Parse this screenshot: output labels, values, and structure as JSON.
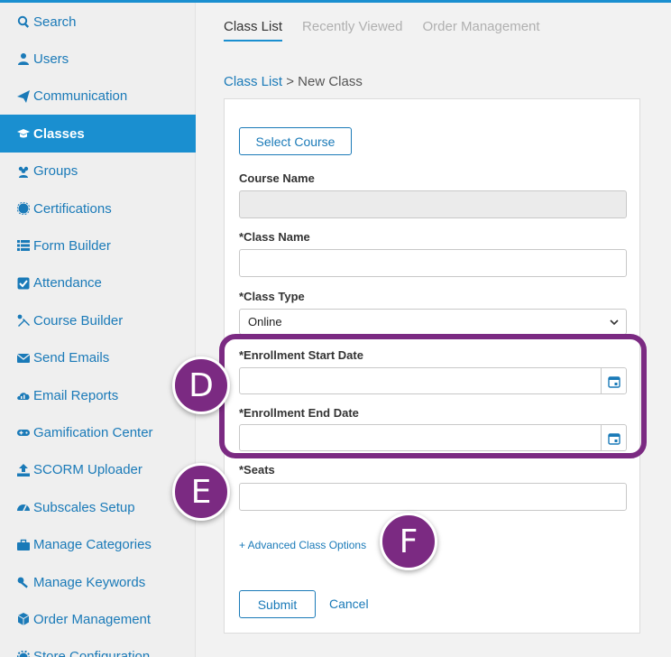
{
  "sidebar": {
    "items": [
      {
        "label": "Search",
        "icon": "search-icon"
      },
      {
        "label": "Users",
        "icon": "user-icon"
      },
      {
        "label": "Communication",
        "icon": "paper-plane-icon"
      },
      {
        "label": "Classes",
        "icon": "graduation-cap-icon",
        "active": true
      },
      {
        "label": "Groups",
        "icon": "users-icon"
      },
      {
        "label": "Certifications",
        "icon": "certificate-icon"
      },
      {
        "label": "Form Builder",
        "icon": "list-icon"
      },
      {
        "label": "Attendance",
        "icon": "check-square-icon"
      },
      {
        "label": "Course Builder",
        "icon": "tools-icon"
      },
      {
        "label": "Send Emails",
        "icon": "envelope-icon"
      },
      {
        "label": "Email Reports",
        "icon": "chart-cloud-icon"
      },
      {
        "label": "Gamification Center",
        "icon": "gamepad-icon"
      },
      {
        "label": "SCORM Uploader",
        "icon": "upload-icon"
      },
      {
        "label": "Subscales Setup",
        "icon": "gauge-icon"
      },
      {
        "label": "Manage Categories",
        "icon": "briefcase-icon"
      },
      {
        "label": "Manage Keywords",
        "icon": "key-icon"
      },
      {
        "label": "Order Management",
        "icon": "cube-icon"
      },
      {
        "label": "Store Configuration",
        "icon": "gear-icon"
      }
    ]
  },
  "tabs": [
    {
      "label": "Class List",
      "active": true
    },
    {
      "label": "Recently Viewed"
    },
    {
      "label": "Order Management"
    }
  ],
  "breadcrumb": {
    "link": "Class List",
    "separator": " > ",
    "current": "New Class"
  },
  "form": {
    "select_course_label": "Select Course",
    "course_name_label": "Course Name",
    "course_name_value": "",
    "class_name_label": "*Class Name",
    "class_name_value": "",
    "class_type_label": "*Class Type",
    "class_type_value": "Online",
    "enroll_start_label": "*Enrollment Start Date",
    "enroll_start_value": "",
    "enroll_end_label": "*Enrollment End Date",
    "enroll_end_value": "",
    "seats_label": "*Seats",
    "seats_value": "",
    "advanced_label": "+ Advanced Class Options",
    "submit_label": "Submit",
    "cancel_label": "Cancel"
  },
  "annotations": {
    "d": "D",
    "e": "E",
    "f": "F",
    "color": "#7b2a82"
  },
  "colors": {
    "accent": "#1a8fd0",
    "link": "#1a7ab8"
  }
}
